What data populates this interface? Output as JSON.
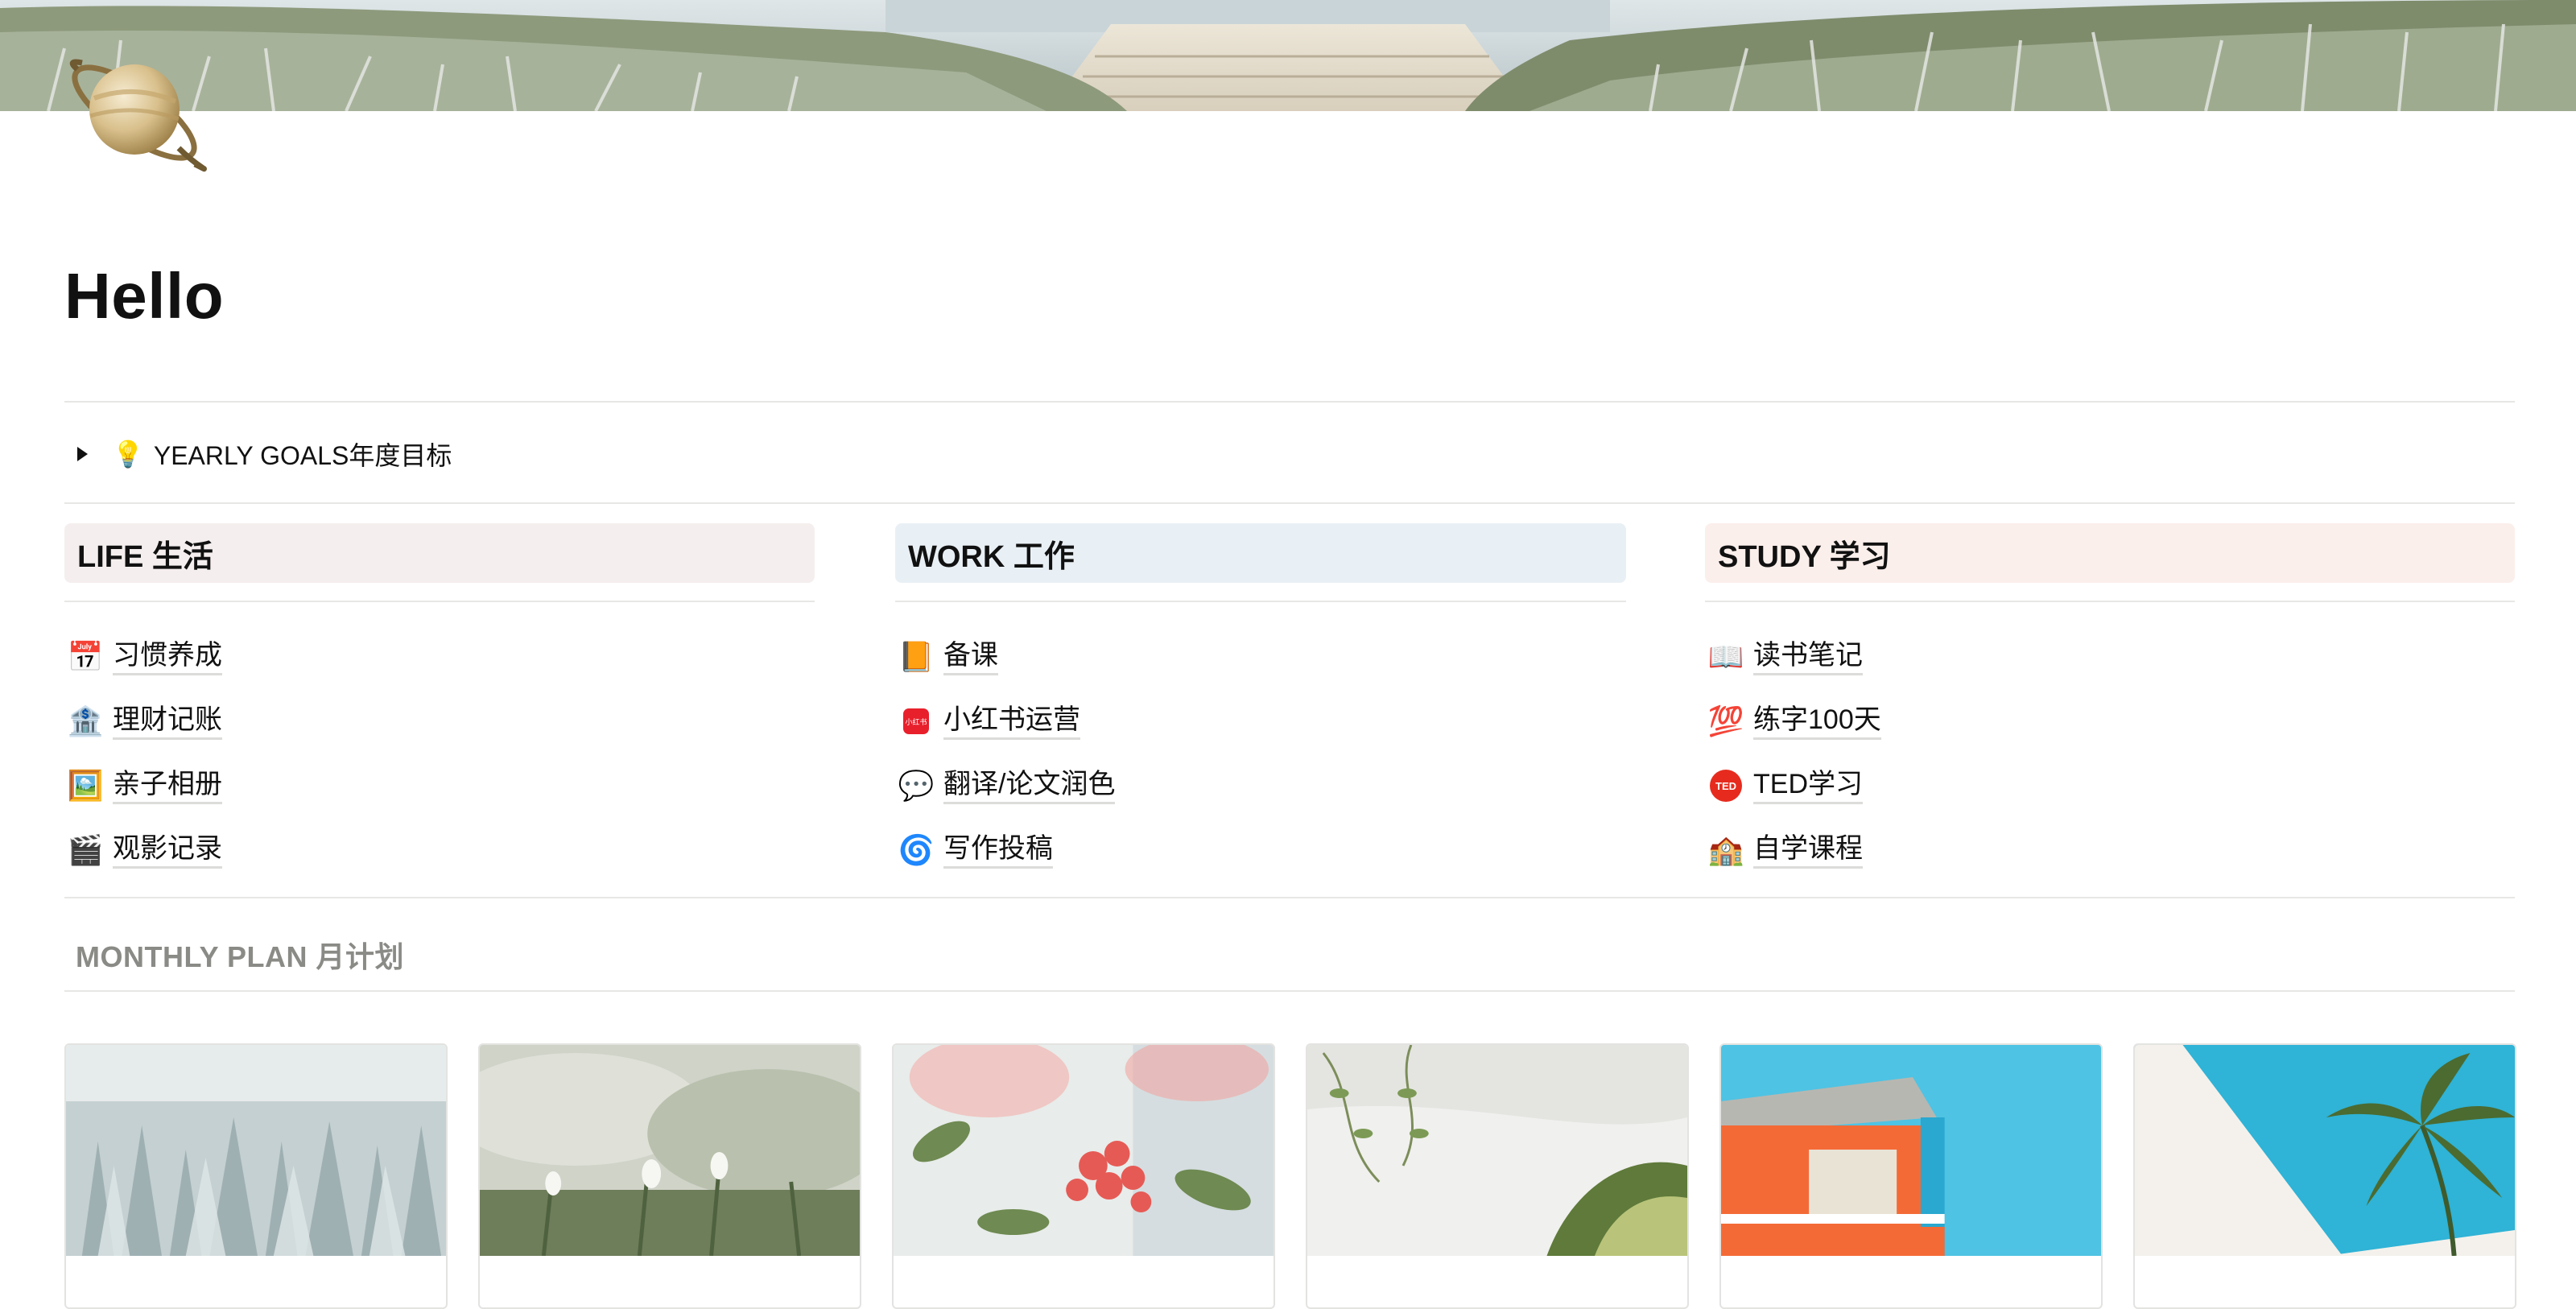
{
  "page": {
    "title": "Hello",
    "icon": "saturn-icon"
  },
  "cover": {
    "icon": "cover-image-seaside-path"
  },
  "toggle": {
    "emoji": "💡",
    "label": "YEARLY GOALS年度目标",
    "icon": "lightbulb-icon"
  },
  "columns": [
    {
      "header": "LIFE 生活",
      "color": "#f4efee",
      "items": [
        {
          "emoji": "📅",
          "label": "习惯养成",
          "icon": "calendar-icon"
        },
        {
          "emoji": "🏦",
          "label": "理财记账",
          "icon": "bank-icon"
        },
        {
          "emoji": "🖼️",
          "label": "亲子相册",
          "icon": "framed-picture-icon"
        },
        {
          "emoji": "🎬",
          "label": "观影记录",
          "icon": "clapper-icon"
        }
      ]
    },
    {
      "header": "WORK 工作",
      "color": "#e9f0f5",
      "items": [
        {
          "emoji": "📙",
          "label": "备课",
          "icon": "orange-book-icon"
        },
        {
          "emoji": "",
          "label": "小红书运营",
          "icon": "xiaohongshu-logo-icon"
        },
        {
          "emoji": "💬",
          "label": "翻译/论文润色",
          "icon": "speech-bubble-icon"
        },
        {
          "emoji": "🌀",
          "label": "写作投稿",
          "icon": "cyclone-icon"
        }
      ]
    },
    {
      "header": "STUDY 学习",
      "color": "#fbefeb",
      "items": [
        {
          "emoji": "📖",
          "label": "读书笔记",
          "icon": "open-book-icon"
        },
        {
          "emoji": "💯",
          "label": "练字100天",
          "icon": "hundred-points-icon"
        },
        {
          "emoji": "",
          "label": "TED学习",
          "icon": "ted-logo-icon"
        },
        {
          "emoji": "🏫",
          "label": "自学课程",
          "icon": "school-icon"
        }
      ]
    }
  ],
  "monthly": {
    "heading": "MONTHLY PLAN 月计划",
    "cards": [
      {
        "icon": "card-image-frosted-forest"
      },
      {
        "icon": "card-image-snowdrops"
      },
      {
        "icon": "card-image-pink-blossoms"
      },
      {
        "icon": "card-image-white-wall-plants"
      },
      {
        "icon": "card-image-lifeguard-hut"
      },
      {
        "icon": "card-image-palm-tree"
      }
    ]
  },
  "colors": {
    "xiaohongshu": "#e8202c",
    "ted": "#e62b1e",
    "divider": "#e7e7e5"
  },
  "logos": {
    "xiaohongshu_text": "小红书",
    "ted_text": "TED"
  }
}
